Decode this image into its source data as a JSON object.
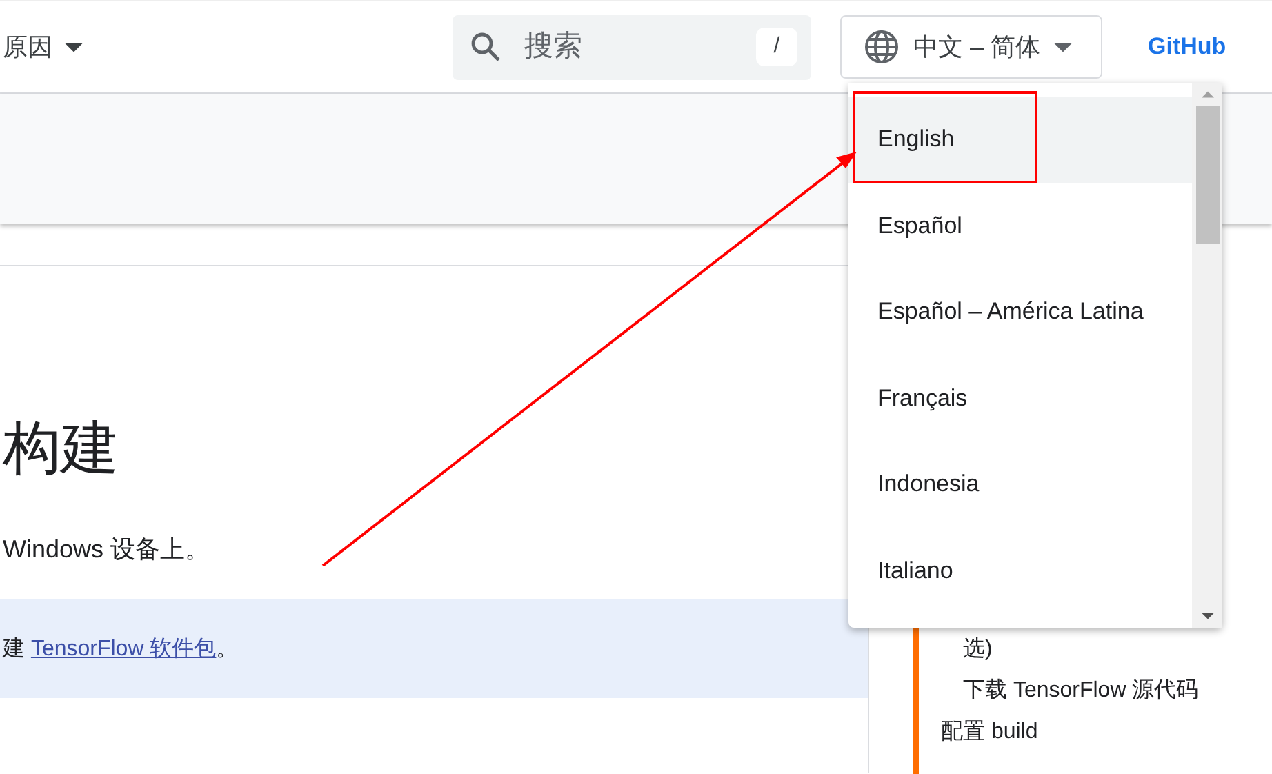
{
  "header": {
    "nav_item": "原因",
    "search": {
      "placeholder": "搜索",
      "shortcut": "/"
    },
    "language_button": "中文 – 简体",
    "github_link": "GitHub"
  },
  "article": {
    "title": "构建",
    "paragraph": "Windows 设备上。",
    "note": {
      "prefix": "建 ",
      "link": "TensorFlow 软件包",
      "suffix": "。"
    }
  },
  "toc": {
    "nested_items": [
      "选)",
      "下载 TensorFlow 源代码"
    ],
    "items": [
      "配置 build"
    ]
  },
  "language_menu": {
    "items": [
      {
        "label": "English",
        "selected": true
      },
      {
        "label": "Español",
        "selected": false
      },
      {
        "label": "Español – América Latina",
        "selected": false
      },
      {
        "label": "Français",
        "selected": false
      },
      {
        "label": "Indonesia",
        "selected": false
      },
      {
        "label": "Italiano",
        "selected": false
      }
    ]
  }
}
